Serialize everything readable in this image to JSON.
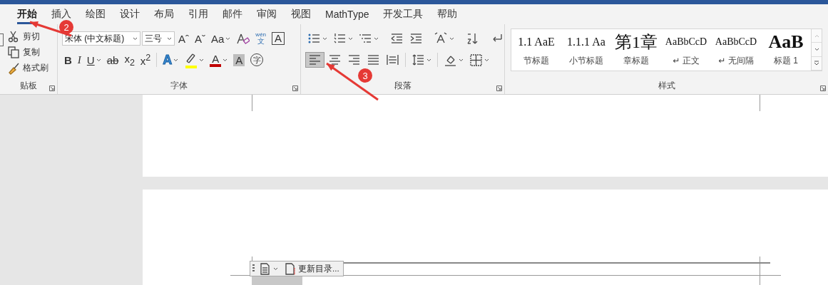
{
  "tabs": [
    {
      "label": "开始",
      "selected": true
    },
    {
      "label": "插入",
      "selected": false
    },
    {
      "label": "绘图",
      "selected": false
    },
    {
      "label": "设计",
      "selected": false
    },
    {
      "label": "布局",
      "selected": false
    },
    {
      "label": "引用",
      "selected": false
    },
    {
      "label": "邮件",
      "selected": false
    },
    {
      "label": "审阅",
      "selected": false
    },
    {
      "label": "视图",
      "selected": false
    },
    {
      "label": "MathType",
      "selected": false
    },
    {
      "label": "开发工具",
      "selected": false
    },
    {
      "label": "帮助",
      "selected": false
    }
  ],
  "clipboard": {
    "buttons": [
      {
        "label": "剪切"
      },
      {
        "label": "复制"
      },
      {
        "label": "格式刷"
      }
    ],
    "group_label": "贴板"
  },
  "font": {
    "font_name": "宋体 (中文标题)",
    "font_size": "三号",
    "row1": [
      {
        "kind": "text",
        "label": "Aˆ",
        "dropdown": false
      },
      {
        "kind": "text",
        "label": "Aˇ",
        "dropdown": false
      },
      {
        "kind": "text",
        "label": "Aa",
        "dropdown": true
      },
      {
        "kind": "icon",
        "dropdown": false
      },
      {
        "kind": "phonetic",
        "label": "wén",
        "sub": "文",
        "dropdown": false
      },
      {
        "kind": "boxed",
        "label": "A",
        "dropdown": false
      }
    ],
    "row2": [
      {
        "kind": "text",
        "label": "B",
        "dropdown": false
      },
      {
        "kind": "text",
        "label": "I",
        "dropdown": false
      },
      {
        "kind": "text",
        "label": "U",
        "dropdown": true
      },
      {
        "kind": "text",
        "label": "ab",
        "dropdown": false
      },
      {
        "kind": "text",
        "label": "x$_{2}$",
        "dropdown": false
      },
      {
        "kind": "text",
        "label": "x$^{2}$",
        "dropdown": false
      },
      {
        "kind": "effect",
        "label": "A",
        "dropdown": true
      },
      {
        "kind": "colorbar-icon",
        "color": "#ffff00",
        "dropdown": true
      },
      {
        "kind": "colorbar",
        "label": "A",
        "color": "#c00000",
        "dropdown": true
      },
      {
        "kind": "shaded",
        "label": "A",
        "dropdown": false
      },
      {
        "kind": "circled",
        "label": "字",
        "dropdown": false
      }
    ],
    "group_label": "字体"
  },
  "paragraph": {
    "row1": [
      {
        "dropdown": true
      },
      {
        "dropdown": true
      },
      {
        "dropdown": true
      },
      {
        "dropdown": false
      },
      {
        "dropdown": false
      },
      {
        "dropdown": true
      },
      {
        "dropdown": false
      },
      {
        "dropdown": false
      }
    ],
    "row2": [
      {
        "selected": true,
        "dropdown": false
      },
      {
        "selected": false,
        "dropdown": false
      },
      {
        "selected": false,
        "dropdown": false
      },
      {
        "selected": false,
        "dropdown": false
      },
      {
        "selected": false,
        "dropdown": false
      },
      {
        "selected": false,
        "dropdown": true
      },
      {
        "selected": false,
        "dropdown": true
      },
      {
        "selected": false,
        "dropdown": true
      }
    ],
    "group_label": "段落"
  },
  "styles": {
    "items": [
      {
        "preview": "1.1  AaE",
        "name": "节标题",
        "kind": "serif"
      },
      {
        "preview": "1.1.1  Aa",
        "name": "小节标题",
        "kind": "serif"
      },
      {
        "preview": "第1章",
        "name": "章标题",
        "kind": "chapter"
      },
      {
        "preview": "AaBbCcD",
        "name": "↵ 正文",
        "kind": "small"
      },
      {
        "preview": "AaBbCcD",
        "name": "↵ 无间隔",
        "kind": "small"
      },
      {
        "preview": "AaB",
        "name": "标题 1",
        "kind": "heading"
      }
    ],
    "group_label": "样式"
  },
  "document": {
    "toc_button": "更新目录..."
  },
  "annotations": [
    {
      "label": "2"
    },
    {
      "label": "3"
    }
  ]
}
